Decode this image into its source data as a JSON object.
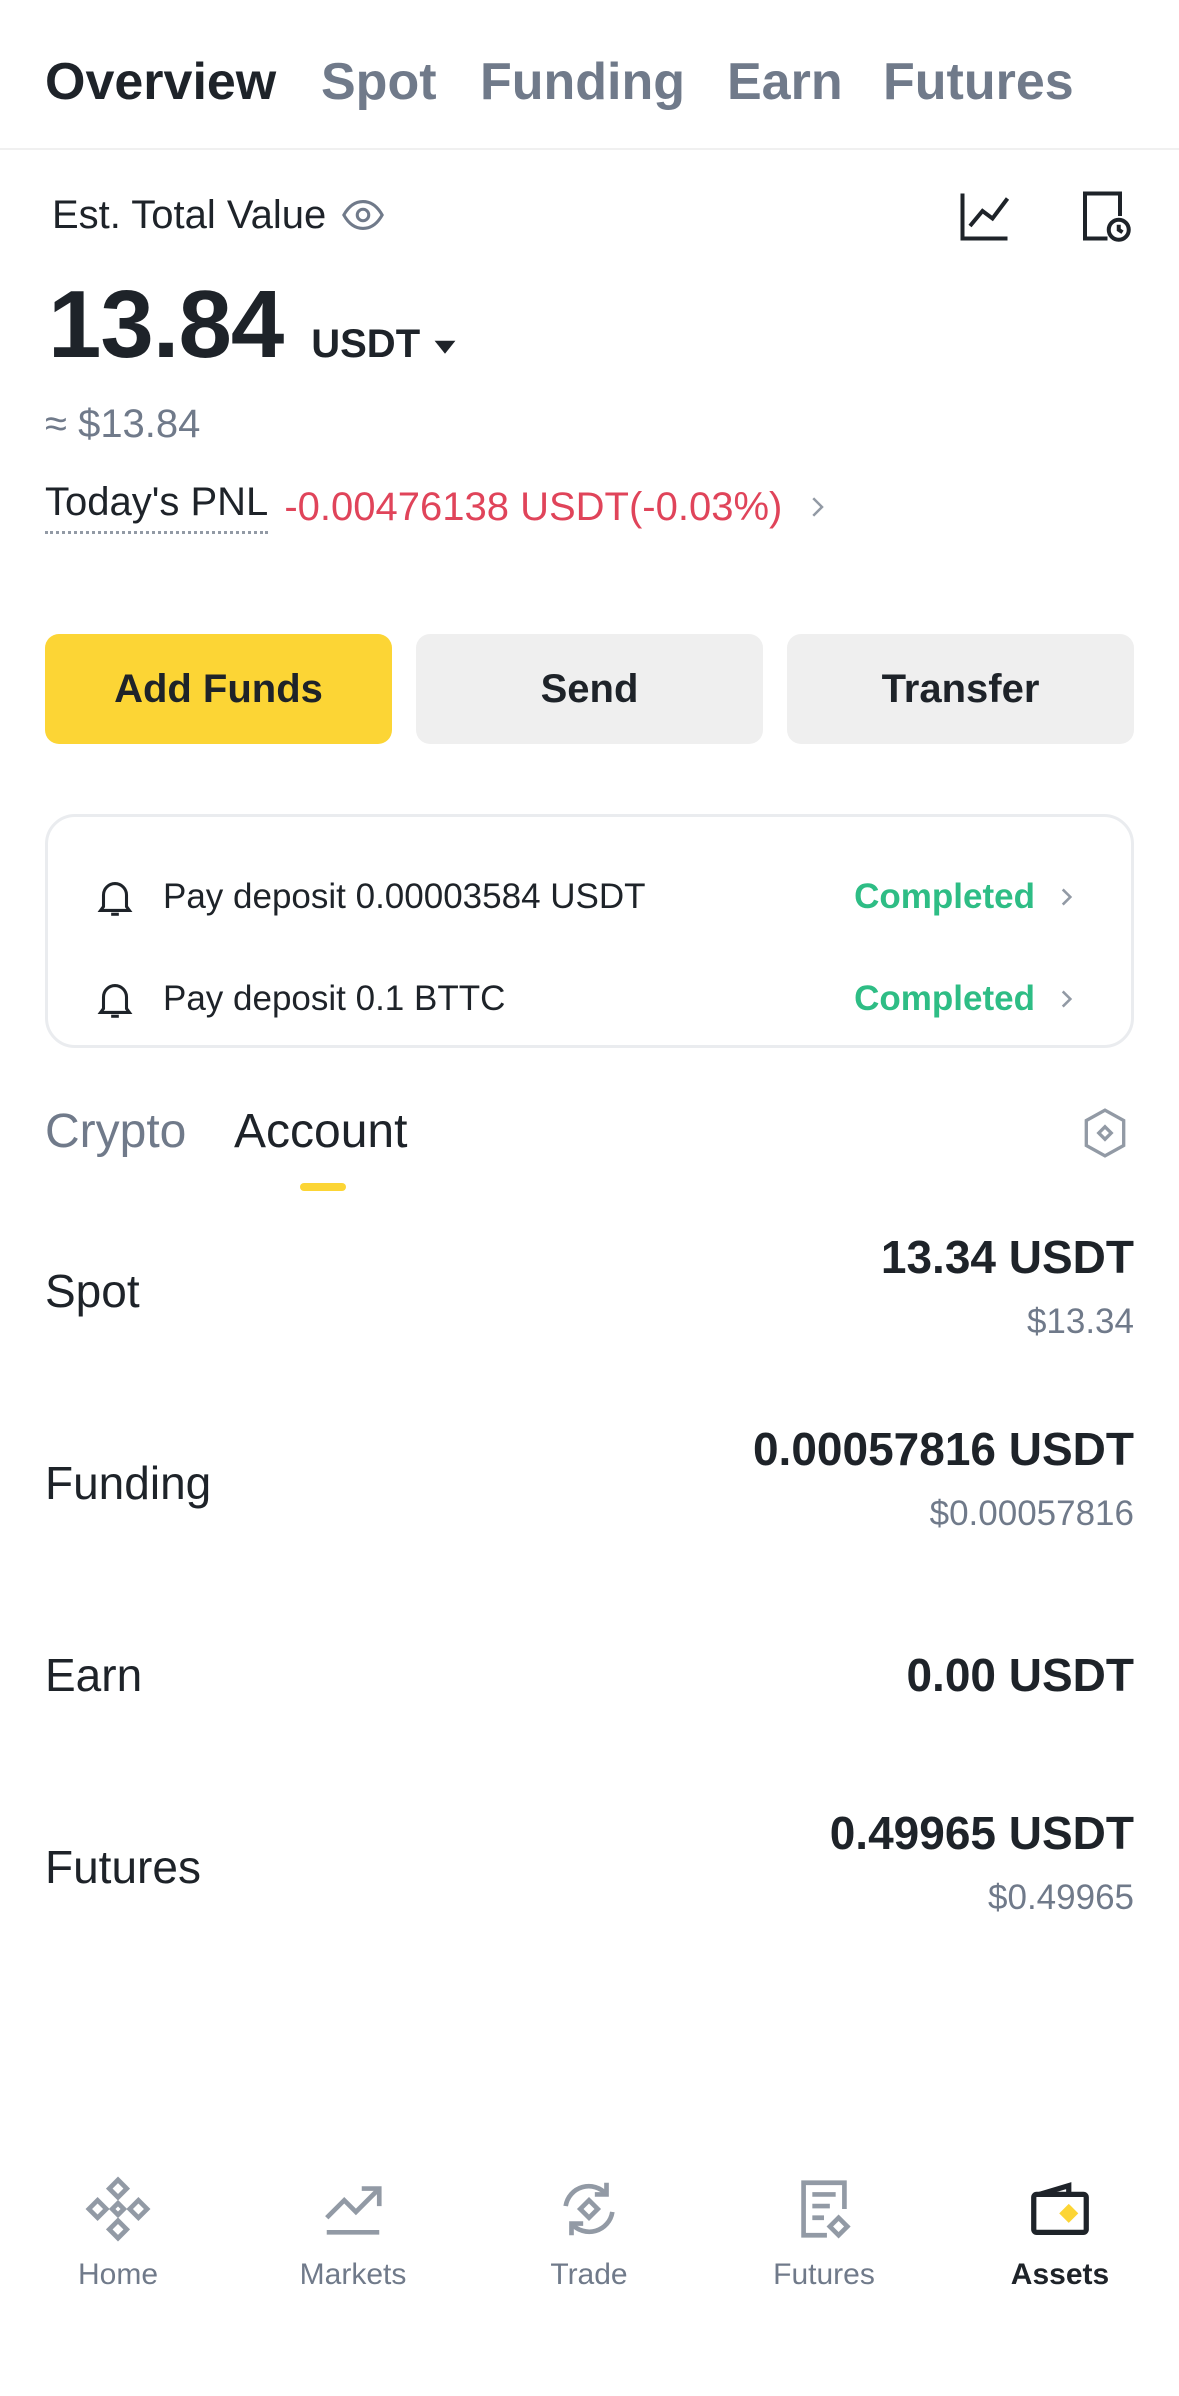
{
  "top_tabs": {
    "overview": "Overview",
    "spot": "Spot",
    "funding": "Funding",
    "earn": "Earn",
    "futures": "Futures"
  },
  "summary": {
    "est_label": "Est. Total Value",
    "total_value": "13.84",
    "currency": "USDT",
    "usd_approx": "≈ $13.84",
    "pnl_label": "Today's PNL",
    "pnl_value": "-0.00476138 USDT(-0.03%)"
  },
  "actions": {
    "add_funds": "Add Funds",
    "send": "Send",
    "transfer": "Transfer"
  },
  "notifications": [
    {
      "text": "Pay deposit 0.00003584 USDT",
      "status": "Completed"
    },
    {
      "text": "Pay deposit 0.1 BTTC",
      "status": "Completed"
    }
  ],
  "section_tabs": {
    "crypto": "Crypto",
    "account": "Account"
  },
  "accounts": [
    {
      "name": "Spot",
      "amount": "13.34 USDT",
      "usd": "$13.34"
    },
    {
      "name": "Funding",
      "amount": "0.00057816 USDT",
      "usd": "$0.00057816"
    },
    {
      "name": "Earn",
      "amount": "0.00 USDT",
      "usd": ""
    },
    {
      "name": "Futures",
      "amount": "0.49965 USDT",
      "usd": "$0.49965"
    }
  ],
  "bottom_nav": {
    "home": "Home",
    "markets": "Markets",
    "trade": "Trade",
    "futures": "Futures",
    "assets": "Assets"
  },
  "colors": {
    "accent": "#fcd535",
    "negative": "#e0445a",
    "positive": "#2ebd85",
    "muted": "#707a8a"
  },
  "icons": {
    "eye": "eye-icon",
    "chart": "line-chart-icon",
    "history": "document-clock-icon",
    "bell": "bell-icon",
    "hexagon": "hexagon-settings-icon"
  }
}
